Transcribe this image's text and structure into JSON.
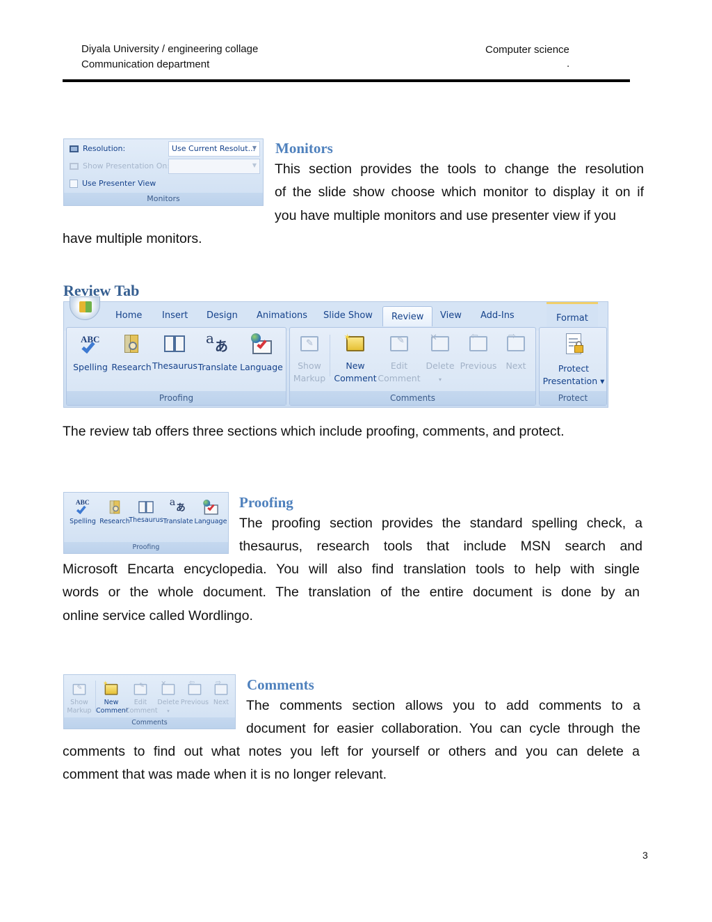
{
  "header": {
    "left_line1": "Diyala University / engineering collage",
    "left_line2": "Communication department",
    "right_line1": "Computer science",
    "right_line2": "."
  },
  "monitors": {
    "heading": "Monitors",
    "ribbon": {
      "resolution_label": "Resolution:",
      "resolution_value": "Use Current Resolut...",
      "show_on_label": "Show Presentation On:",
      "show_on_value": "",
      "presenter_view_label": "Use Presenter View",
      "presenter_view_checked": false,
      "group_label": "Monitors"
    },
    "para_lines": [
      "This section provides the tools to change the resolution",
      "of the slide show choose which monitor to display it on if",
      "you have multiple monitors and use presenter view if you",
      "have multiple monitors."
    ]
  },
  "review_tab": {
    "heading": "Review Tab",
    "tabs": [
      "Home",
      "Insert",
      "Design",
      "Animations",
      "Slide Show",
      "Review",
      "View",
      "Add-Ins",
      "Format"
    ],
    "active_tab": "Review",
    "groups": {
      "proofing": {
        "label": "Proofing",
        "buttons": [
          {
            "label": "Spelling",
            "icon": "spelling-abc-check-icon"
          },
          {
            "label": "Research",
            "icon": "research-books-magnifier-icon"
          },
          {
            "label": "Thesaurus",
            "icon": "thesaurus-book-icon"
          },
          {
            "label": "Translate",
            "icon": "translate-icon"
          },
          {
            "label": "Language",
            "icon": "language-globe-icon"
          }
        ]
      },
      "comments": {
        "label": "Comments",
        "buttons": [
          {
            "label1": "Show",
            "label2": "Markup",
            "enabled": false
          },
          {
            "label1": "New",
            "label2": "Comment",
            "enabled": true
          },
          {
            "label1": "Edit",
            "label2": "Comment",
            "enabled": false
          },
          {
            "label1": "Delete",
            "label2": "▾",
            "enabled": false
          },
          {
            "label1": "Previous",
            "label2": "",
            "enabled": false
          },
          {
            "label1": "Next",
            "label2": "",
            "enabled": false
          }
        ]
      },
      "protect": {
        "label": "Protect",
        "button_line1": "Protect",
        "button_line2": "Presentation ▾"
      }
    },
    "caption": "The review tab offers three sections which include proofing, comments, and protect."
  },
  "proofing": {
    "heading": "Proofing",
    "para_lines": [
      "The proofing section provides the standard spelling check, a",
      "thesaurus, research tools that include MSN search and",
      "Microsoft Encarta encyclopedia.  You will also find translation tools to help with single",
      "words or the whole document.  The translation of the entire document is done by an",
      "online service called Wordlingo."
    ]
  },
  "comments": {
    "heading": "Comments",
    "para_lines": [
      "The comments section allows you to add comments to a",
      "document for easier collaboration.  You can cycle through the",
      "comments to find out what notes you left for yourself or others and you can delete a",
      "comment that was made when it is no longer relevant."
    ]
  },
  "page_number": "3"
}
